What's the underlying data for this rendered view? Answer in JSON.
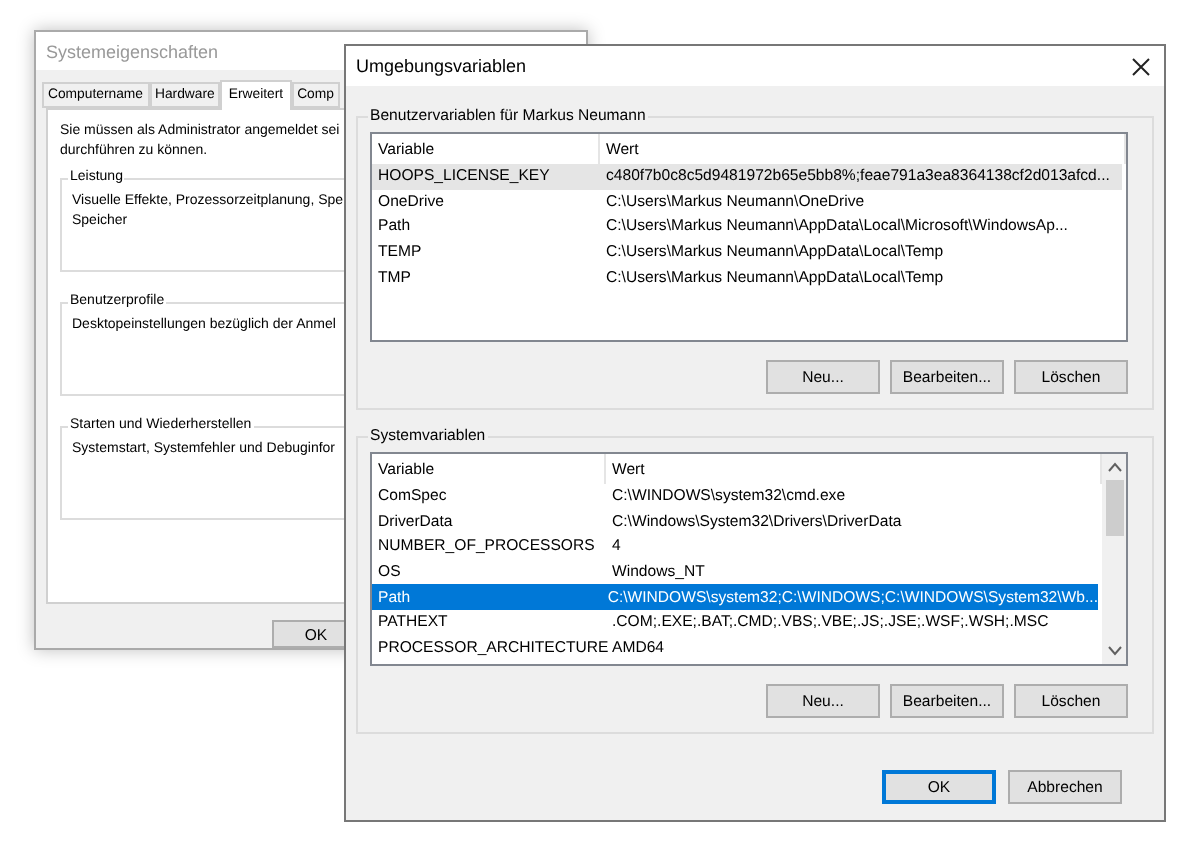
{
  "back_window": {
    "title": "Systemeigenschaften",
    "tabs": [
      {
        "label": "Computername",
        "selected": false
      },
      {
        "label": "Hardware",
        "selected": false
      },
      {
        "label": "Erweitert",
        "selected": true
      },
      {
        "label": "Comp",
        "selected": false
      }
    ],
    "intro": [
      "Sie müssen als Administrator angemeldet sei",
      "durchführen zu können."
    ],
    "sections": [
      {
        "title": "Leistung",
        "lines": [
          "Visuelle Effekte, Prozessorzeitplanung, Spe",
          "Speicher"
        ]
      },
      {
        "title": "Benutzerprofile",
        "lines": [
          "Desktopeinstellungen bezüglich der Anmel"
        ]
      },
      {
        "title": "Starten und Wiederherstellen",
        "lines": [
          "Systemstart, Systemfehler und Debuginfor"
        ]
      }
    ],
    "ok_button": "OK"
  },
  "front_window": {
    "title": "Umgebungsvariablen",
    "groups": [
      {
        "title": "Benutzervariablen für Markus Neumann",
        "focused": false,
        "columns": [
          "Variable",
          "Wert"
        ],
        "rows": [
          {
            "name": "HOOPS_LICENSE_KEY",
            "value": "c480f7b0c8c5d9481972b65e5bb8%;feae791a3ea8364138cf2d013afcd...",
            "selected": true
          },
          {
            "name": "OneDrive",
            "value": "C:\\Users\\Markus Neumann\\OneDrive",
            "selected": false
          },
          {
            "name": "Path",
            "value": "C:\\Users\\Markus Neumann\\AppData\\Local\\Microsoft\\WindowsAp...",
            "selected": false
          },
          {
            "name": "TEMP",
            "value": "C:\\Users\\Markus Neumann\\AppData\\Local\\Temp",
            "selected": false
          },
          {
            "name": "TMP",
            "value": "C:\\Users\\Markus Neumann\\AppData\\Local\\Temp",
            "selected": false
          }
        ],
        "buttons": [
          "Neu...",
          "Bearbeiten...",
          "Löschen"
        ]
      },
      {
        "title": "Systemvariablen",
        "focused": true,
        "scrollbar": true,
        "columns": [
          "Variable",
          "Wert"
        ],
        "rows": [
          {
            "name": "ComSpec",
            "value": "C:\\WINDOWS\\system32\\cmd.exe",
            "selected": false
          },
          {
            "name": "DriverData",
            "value": "C:\\Windows\\System32\\Drivers\\DriverData",
            "selected": false
          },
          {
            "name": "NUMBER_OF_PROCESSORS",
            "value": "4",
            "selected": false
          },
          {
            "name": "OS",
            "value": "Windows_NT",
            "selected": false
          },
          {
            "name": "Path",
            "value": "C:\\WINDOWS\\system32;C:\\WINDOWS;C:\\WINDOWS\\System32\\Wb...",
            "selected": true
          },
          {
            "name": "PATHEXT",
            "value": ".COM;.EXE;.BAT;.CMD;.VBS;.VBE;.JS;.JSE;.WSF;.WSH;.MSC",
            "selected": false
          },
          {
            "name": "PROCESSOR_ARCHITECTURE",
            "value": "AMD64",
            "selected": false
          }
        ],
        "buttons": [
          "Neu...",
          "Bearbeiten...",
          "Löschen"
        ]
      }
    ],
    "buttons": [
      {
        "label": "OK",
        "default": true
      },
      {
        "label": "Abbrechen",
        "default": false
      }
    ]
  }
}
